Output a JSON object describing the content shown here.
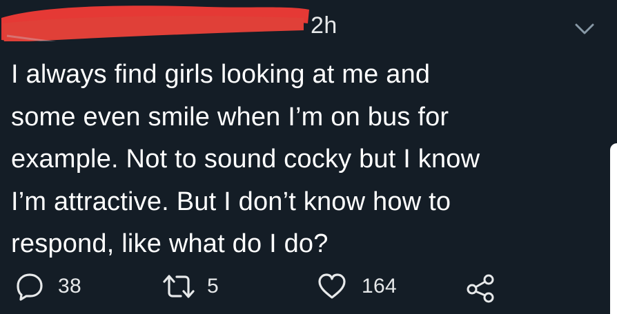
{
  "tweet": {
    "timestamp": "2h",
    "text": "I always find girls looking at me and\nsome even smile when I’m on bus for\nexample. Not to sound cocky but I know\nI’m attractive. But I don’t know how to\nrespond, like what do I do?",
    "redaction_color": "#e53935",
    "actions": {
      "reply_count": "38",
      "retweet_count": "5",
      "like_count": "164"
    },
    "icons": {
      "reply": "reply-icon",
      "retweet": "retweet-icon",
      "like": "heart-icon",
      "share": "share-icon",
      "menu": "chevron-down-icon"
    }
  },
  "theme": {
    "background": "#141d26",
    "text": "#ffffff",
    "muted": "#8899a6"
  }
}
